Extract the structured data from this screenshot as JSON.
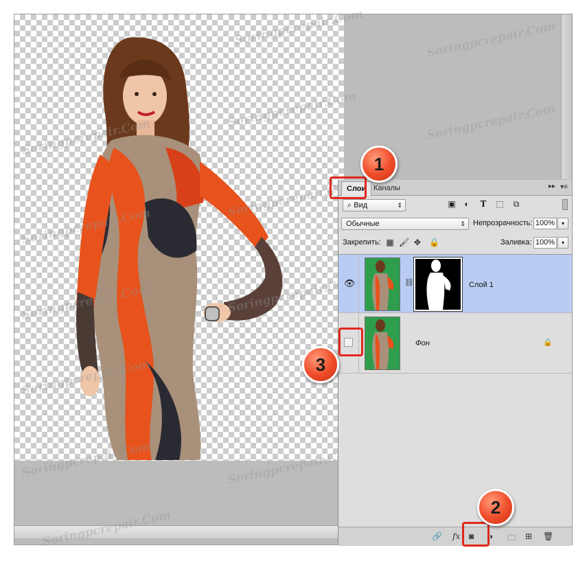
{
  "watermark": "Soringpcrepair.Com",
  "layers_panel": {
    "tabs": [
      "Слои",
      "Каналы"
    ],
    "filter_kind": "Вид",
    "blend_mode": "Обычные",
    "opacity_label": "Непрозрачность:",
    "opacity_value": "100%",
    "lock_label": "Закрепить:",
    "fill_label": "Заливка:",
    "fill_value": "100%",
    "layers": [
      {
        "name": "Слой 1",
        "visible": true,
        "selected": true,
        "has_mask": true
      },
      {
        "name": "Фон",
        "visible": false,
        "selected": false,
        "locked": true
      }
    ]
  },
  "callouts": [
    "1",
    "2",
    "3"
  ],
  "colors": {
    "callout": "#ef4b28",
    "highlight": "#e0281c",
    "selection": "#b9cdf4",
    "green_screen": "#2e9e4c",
    "canvas_bg": "#bcbcbc"
  },
  "icons": {
    "eye": "eye-icon",
    "chain": "link-chain-icon",
    "lock": "lock-icon",
    "bottom_bar": [
      "link-layers-icon",
      "fx-icon",
      "add-mask-icon",
      "adjustment-icon",
      "new-group-icon",
      "new-layer-icon",
      "trash-icon"
    ]
  }
}
